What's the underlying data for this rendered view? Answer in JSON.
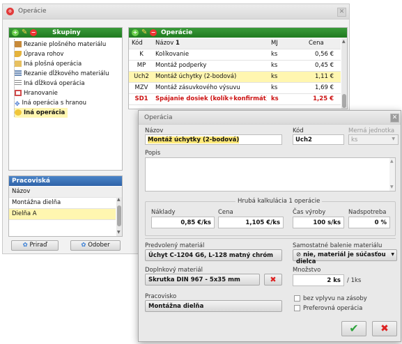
{
  "main_window": {
    "title": "Operácie"
  },
  "groups": {
    "header": "Skupiny",
    "items": [
      "Rezanie plošného materiálu",
      "Úprava rohov",
      "Iná plošná operácia",
      "Rezanie dĺžkového materiálu",
      "Iná dĺžková operácia",
      "Hranovanie",
      "Iná operácia s hranou",
      "Iná operácia"
    ]
  },
  "operations": {
    "header": "Operácie",
    "columns": {
      "code": "Kód",
      "name": "Názov",
      "unit": "MJ",
      "price": "Cena"
    },
    "sort_indicator": "1",
    "rows": [
      {
        "code": "K",
        "name": "Kolíkovanie",
        "unit": "ks",
        "price": "0,56 €"
      },
      {
        "code": "MP",
        "name": "Montáž podperky",
        "unit": "ks",
        "price": "0,45 €"
      },
      {
        "code": "Uch2",
        "name": "Montáž úchytky (2-bodová)",
        "unit": "ks",
        "price": "1,11 €"
      },
      {
        "code": "MZV",
        "name": "Montáž zásuvkového výsuvu",
        "unit": "ks",
        "price": "1,69 €"
      },
      {
        "code": "SD1",
        "name": "Spájanie dosiek (kolík+konfirmát)",
        "unit": "ks",
        "price": "1,25 €"
      }
    ]
  },
  "workplaces": {
    "header": "Pracoviská",
    "column": "Názov",
    "items": [
      "Montážna dielňa",
      "Dielňa A"
    ]
  },
  "buttons": {
    "assign": "Priraď",
    "remove": "Odober"
  },
  "dialog": {
    "title": "Operácia",
    "name_label": "Názov",
    "name_value": "Montáž úchytky (2-bodová)",
    "code_label": "Kód",
    "code_value": "Uch2",
    "unit_label": "Merná jednotka",
    "unit_value": "ks",
    "description_label": "Popis",
    "calc_label": "Hrubá kalkulácia 1 operácie",
    "costs_label": "Náklady",
    "costs_value": "0,85 €/ks",
    "price_label": "Cena",
    "price_value": "1,105 €/ks",
    "time_label": "Čas výroby",
    "time_value": "100 s/ks",
    "surplus_label": "Nadspotreba",
    "surplus_value": "0 %",
    "default_material_label": "Predvolený materiál",
    "default_material_value": "Úchyt C-1204 G6, L-128 matný chróm",
    "packaging_label": "Samostatné balenie materiálu",
    "packaging_value": "nie, materiál je súčasťou dielca",
    "extra_material_label": "Doplnkový materiál",
    "extra_material_value": "Skrutka DIN 967 - 5x35 mm",
    "quantity_label": "Množstvo",
    "quantity_value": "2 ks",
    "quantity_unit": "/ 1ks",
    "workplace_label": "Pracovisko",
    "workplace_value": "Montážna dielňa",
    "no_stock_label": "bez vplyvu na zásoby",
    "preferred_label": "Preferovná operácia"
  },
  "colors": {
    "green_header": "#2a8a2a",
    "blue_header": "#3a72b8",
    "selection": "#fff6b0",
    "highlight_red": "#cc1111"
  }
}
